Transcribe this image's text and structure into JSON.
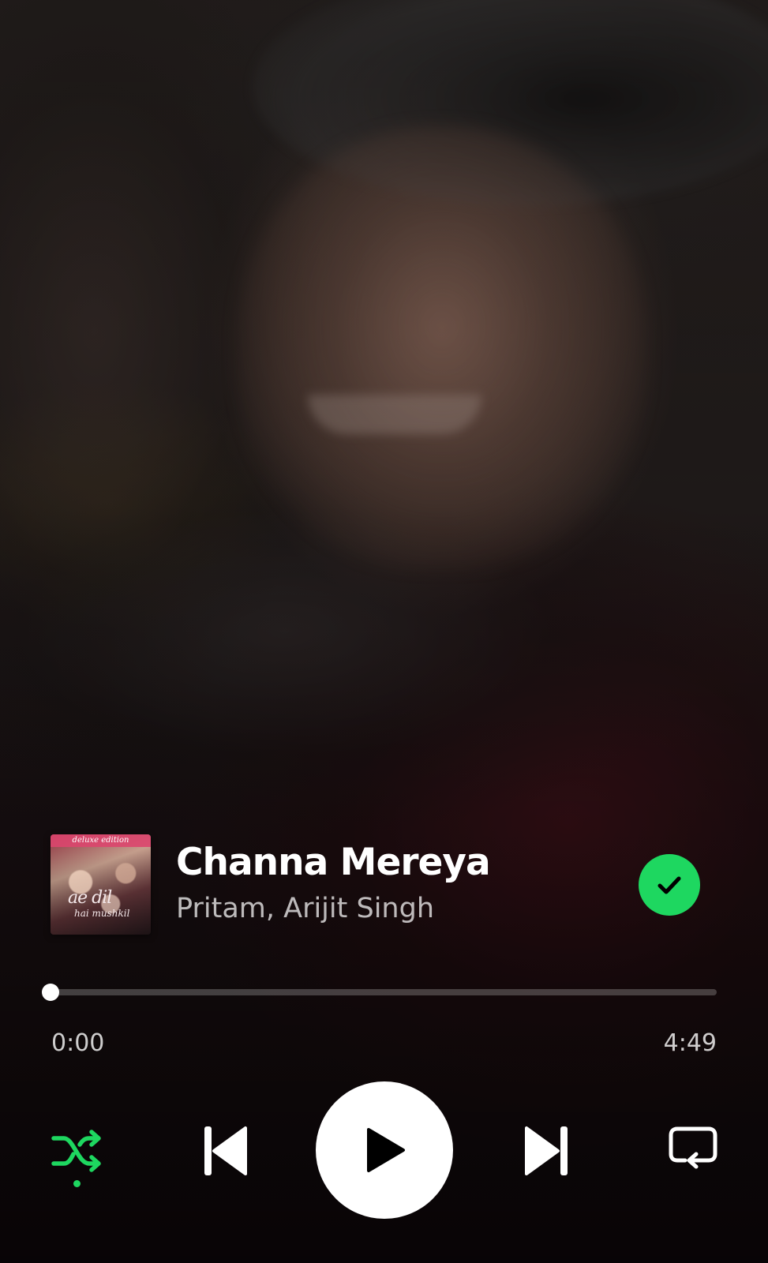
{
  "track": {
    "title": "Channa Mereya",
    "artists": "Pritam, Arijit Singh",
    "liked": true
  },
  "cover": {
    "edition_label": "deluxe edition",
    "title": "ae dil",
    "subtitle": "hai mushkil"
  },
  "progress": {
    "elapsed": "0:00",
    "total": "4:49",
    "fraction": 0
  },
  "controls": {
    "shuffle": "shuffle-icon",
    "shuffle_active": true,
    "previous": "skip-previous-icon",
    "play": "play-icon",
    "next": "skip-next-icon",
    "repeat": "repeat-icon"
  },
  "colors": {
    "accent": "#1ed760",
    "text_primary": "#ffffff",
    "text_secondary": "rgba(255,255,255,0.72)"
  }
}
